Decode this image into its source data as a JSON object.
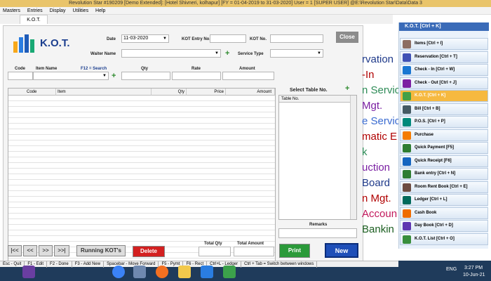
{
  "window": {
    "title": "Revolution Star #190209   [Demo Extended]: [Hotel Shivneri, kolhapur] [FY = 01-04-2019 to 31-03-2020] User = 1 [SUPER USER]  @E:\\Revolution Star\\Data\\Data 3"
  },
  "menu": [
    "Masters",
    "Entries",
    "Display",
    "Utilities",
    "Help"
  ],
  "tab": "K.O.T.",
  "form": {
    "heading": "K.O.T.",
    "date_label": "Date",
    "date_value": "11-03-2020",
    "kot_entry_label": "KOT Entry No.",
    "kot_no_label": "KOT No.",
    "close": "Close",
    "waiter_label": "Waiter Name",
    "service_label": "Service Type",
    "code_label": "Code",
    "item_label": "Item Name",
    "search_hint": "F12 = Search",
    "qty_label": "Qty",
    "rate_label": "Rate",
    "amount_label": "Amount"
  },
  "grid": {
    "columns": [
      "Code",
      "Item",
      "Qty",
      "Price",
      "Amount"
    ]
  },
  "table_panel": {
    "title": "Select Table No.",
    "column": "Table No.",
    "remarks": "Remarks"
  },
  "footer": {
    "first": "|<<",
    "prev": "<<",
    "next": ">>",
    "last": ">>|",
    "running": "Running KOT's",
    "delete": "Delete",
    "total_qty": "Total Qty",
    "total_amount": "Total Amount",
    "print": "Print",
    "new": "New"
  },
  "background_text": [
    {
      "text": "rvation",
      "color": "#1f3a8a"
    },
    {
      "text": "-In",
      "color": "#b00000"
    },
    {
      "text": "n Servic",
      "color": "#2e8b57"
    },
    {
      "text": "Mgt.",
      "color": "#7a1fa2"
    },
    {
      "text": "e Servic",
      "color": "#3a6bd0"
    },
    {
      "text": "matic E",
      "color": "#b00000"
    },
    {
      "text": "k",
      "color": "#2e8b57"
    },
    {
      "text": "uction",
      "color": "#7a1fa2"
    },
    {
      "text": "Board",
      "color": "#1f3a8a"
    },
    {
      "text": "n Mgt.",
      "color": "#b00000"
    },
    {
      "text": "Accoun",
      "color": "#c2185b"
    },
    {
      "text": "Bankin",
      "color": "#1b5e20"
    }
  ],
  "sidebar": {
    "header": "K.O.T. [Ctrl + K]",
    "items": [
      {
        "label": "Items [Ctrl + I]",
        "color": "#8d6e63"
      },
      {
        "label": "Reservation [Ctrl + T]",
        "color": "#3f51b5"
      },
      {
        "label": "Check - In [Ctrl + W]",
        "color": "#1976d2"
      },
      {
        "label": "Check - Out [Ctrl + J]",
        "color": "#7b1fa2"
      },
      {
        "label": "K.O.T. [Ctrl + K]",
        "color": "#43a047"
      },
      {
        "label": "Bill [Ctrl + B]",
        "color": "#455a64"
      },
      {
        "label": "P.O.S. [Ctrl + P]",
        "color": "#00897b"
      },
      {
        "label": "Purchase",
        "color": "#f57c00"
      },
      {
        "label": "Quick Payment [F5]",
        "color": "#2e7d32"
      },
      {
        "label": "Quick Receipt [F6]",
        "color": "#1565c0"
      },
      {
        "label": "Bank entry [Ctrl + N]",
        "color": "#2e7d32"
      },
      {
        "label": "Room Rent Book [Ctrl + E]",
        "color": "#6d4c41"
      },
      {
        "label": "Ledger [Ctrl + L]",
        "color": "#00695c"
      },
      {
        "label": "Cash Book",
        "color": "#ef6c00"
      },
      {
        "label": "Day Book [Ctrl + D]",
        "color": "#5e35b1"
      },
      {
        "label": "K.O.T. List [Ctrl + O]",
        "color": "#388e3c"
      }
    ]
  },
  "status": [
    "Esc - Quit",
    "F1 - Edit",
    "F2 - Done",
    "F3 - Add New",
    "Spacebar - Move Forward",
    "F5 - Pymt",
    "F6 - Rect",
    "Ctrl+L - Ledger",
    "Ctrl + Tab = Switch between windows"
  ],
  "tray": {
    "lang": "ENG",
    "time": "3:27 PM",
    "date": "10-Jun-21"
  }
}
